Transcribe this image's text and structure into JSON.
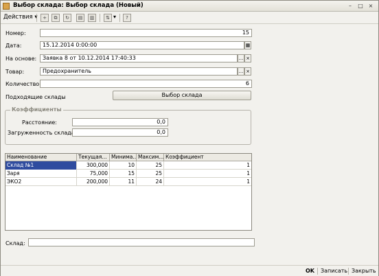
{
  "window": {
    "title": "Выбор склада: Выбор склада (Новый)",
    "controls": [
      "–",
      "□",
      "×"
    ]
  },
  "toolbar": {
    "actions_label": "Действия",
    "help_label": "?"
  },
  "form": {
    "number_label": "Номер:",
    "number_value": "15",
    "date_label": "Дата:",
    "date_value": "15.12.2014  0:00:00",
    "basis_label": "На основе:",
    "basis_value": "Заявка 8 от 10.12.2014 17:40:33",
    "product_label": "Товар:",
    "product_value": "Предохранитель",
    "quantity_label": "Количество:",
    "quantity_value": "6",
    "suitable_label": "Подходящие склады",
    "select_button": "Выбор склада",
    "ellipsis": "...",
    "clear": "×"
  },
  "coefficients": {
    "title": "Коэффициенты",
    "distance_label": "Расстояние:",
    "distance_value": "0,0",
    "load_label": "Загруженность склада:",
    "load_value": "0,0"
  },
  "table": {
    "columns": [
      "Наименование",
      "Текущая...",
      "Минима...",
      "Максим...",
      "Коэффициент"
    ],
    "rows": [
      [
        "Склад №1",
        "300,000",
        "10",
        "25",
        "1"
      ],
      [
        "Заря",
        "75,000",
        "15",
        "25",
        "1"
      ],
      [
        "ЭКО2",
        "200,000",
        "11",
        "24",
        "1"
      ]
    ]
  },
  "warehouse_label": "Склад:",
  "warehouse_value": "",
  "footer": {
    "ok": "OK",
    "save": "Записать",
    "close": "Закрыть"
  }
}
